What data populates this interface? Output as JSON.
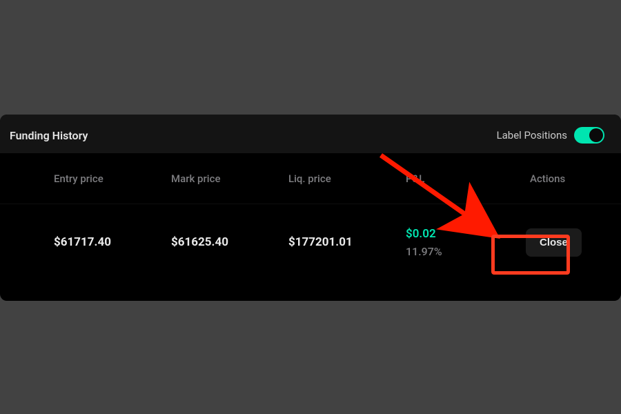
{
  "header": {
    "title": "Funding History",
    "toggle_label": "Label Positions",
    "toggle_on": true
  },
  "table": {
    "columns": {
      "entry": "Entry price",
      "mark": "Mark price",
      "liq": "Liq. price",
      "pnl": "P&L",
      "actions": "Actions"
    },
    "row": {
      "entry": "$61717.40",
      "mark": "$61625.40",
      "liq": "$177201.01",
      "pnl_value": "$0.02",
      "pnl_pct": "11.97%",
      "close_label": "Close"
    }
  },
  "annotation": {
    "arrow_color": "#ff1a00",
    "highlight_color": "#ff3b1f"
  }
}
